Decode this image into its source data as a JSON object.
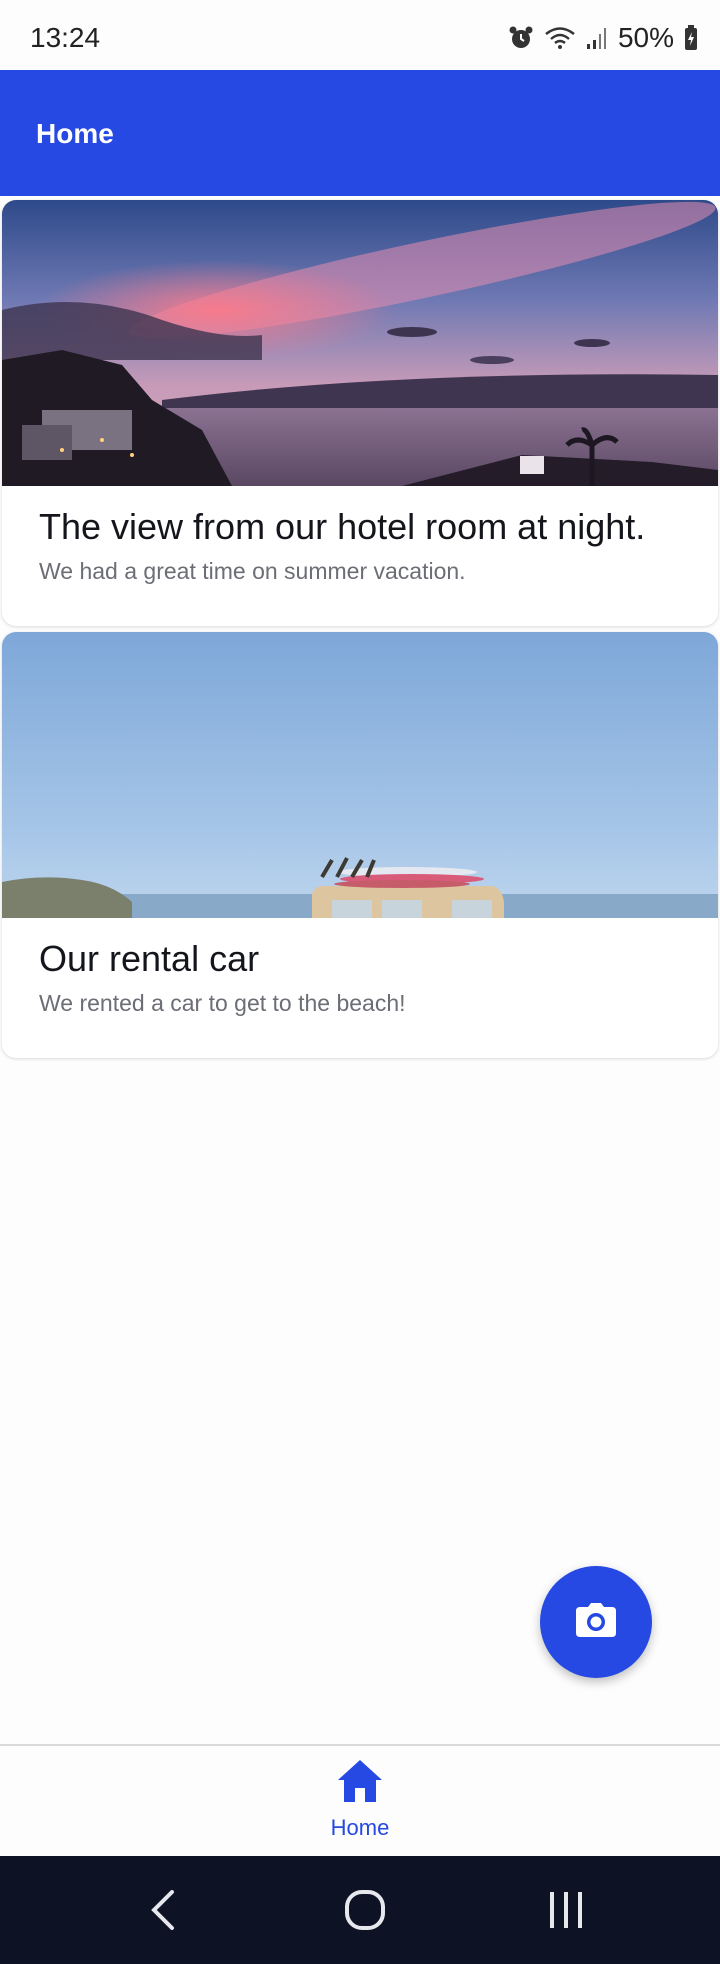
{
  "status_bar": {
    "time": "13:24",
    "battery": "50%",
    "icons": [
      "alarm-icon",
      "wifi-icon",
      "signal-icon",
      "battery-icon"
    ]
  },
  "app_bar": {
    "title": "Home"
  },
  "posts": [
    {
      "title": "The view from our hotel room at night.",
      "description": "We had a great time on summer vacation.",
      "image": "sunset-sea-photo"
    },
    {
      "title": "Our rental car",
      "description": "We rented a car to get to the beach!",
      "image": "van-surfboards-photo"
    }
  ],
  "fab": {
    "icon": "camera-icon"
  },
  "bottom_nav": {
    "items": [
      {
        "label": "Home",
        "icon": "home-icon",
        "selected": true
      }
    ]
  },
  "system_nav": [
    "back-icon",
    "home-circle-icon",
    "recents-icon"
  ],
  "colors": {
    "primary": "#2549e2",
    "system_nav_bg": "#0d1324",
    "title_text": "#14161c",
    "subtitle_text": "#6b6e75"
  }
}
